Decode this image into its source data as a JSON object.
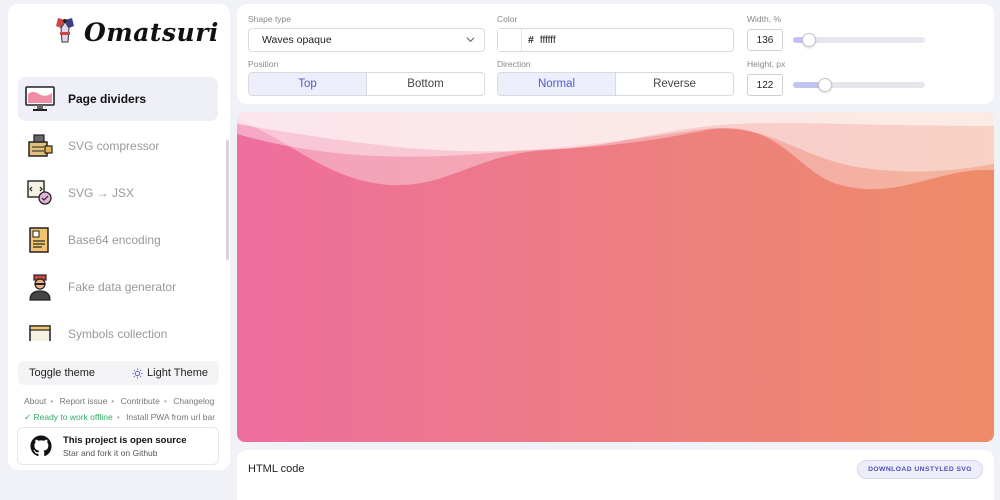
{
  "app": {
    "name": "Omatsuri"
  },
  "sidebar": {
    "items": [
      {
        "label": "Page dividers",
        "icon": "monitor-icon",
        "active": true
      },
      {
        "label": "SVG compressor",
        "icon": "vise-icon"
      },
      {
        "label": "SVG → JSX",
        "icon": "code-card-icon"
      },
      {
        "label": "Base64 encoding",
        "icon": "document-icon"
      },
      {
        "label": "Fake data generator",
        "icon": "person-icon"
      },
      {
        "label": "Symbols collection",
        "icon": "symbols-icon"
      }
    ],
    "theme": {
      "toggle_label": "Toggle theme",
      "current_label": "Light Theme"
    },
    "links": [
      "About",
      "Report issue",
      "Contribute",
      "Changelog"
    ],
    "offline_status": "✓ Ready to work offline",
    "pwa_hint": "Install PWA from url bar",
    "open_source": {
      "title": "This project is open source",
      "subtitle": "Star and fork it on Github"
    }
  },
  "controls": {
    "shape_type": {
      "label": "Shape type",
      "value": "Waves opaque"
    },
    "color": {
      "label": "Color",
      "hash": "#",
      "value": "ffffff"
    },
    "width": {
      "label": "Width, %",
      "value": "136",
      "slider_fraction": 0.12
    },
    "position": {
      "label": "Position",
      "options": [
        "Top",
        "Bottom"
      ],
      "selected": "Top"
    },
    "direction": {
      "label": "Direction",
      "options": [
        "Normal",
        "Reverse"
      ],
      "selected": "Normal"
    },
    "height": {
      "label": "Height, px",
      "value": "122",
      "slider_fraction": 0.24
    }
  },
  "preview": {
    "gradient_start": "#ee6e9e",
    "gradient_end": "#ee8c68"
  },
  "code_section": {
    "title": "HTML code",
    "download_label": "DOWNLOAD UNSTYLED SVG"
  },
  "colors": {
    "accent": "#4f5fc8",
    "accent_bg": "#eceefb",
    "ok": "#2fae67"
  }
}
